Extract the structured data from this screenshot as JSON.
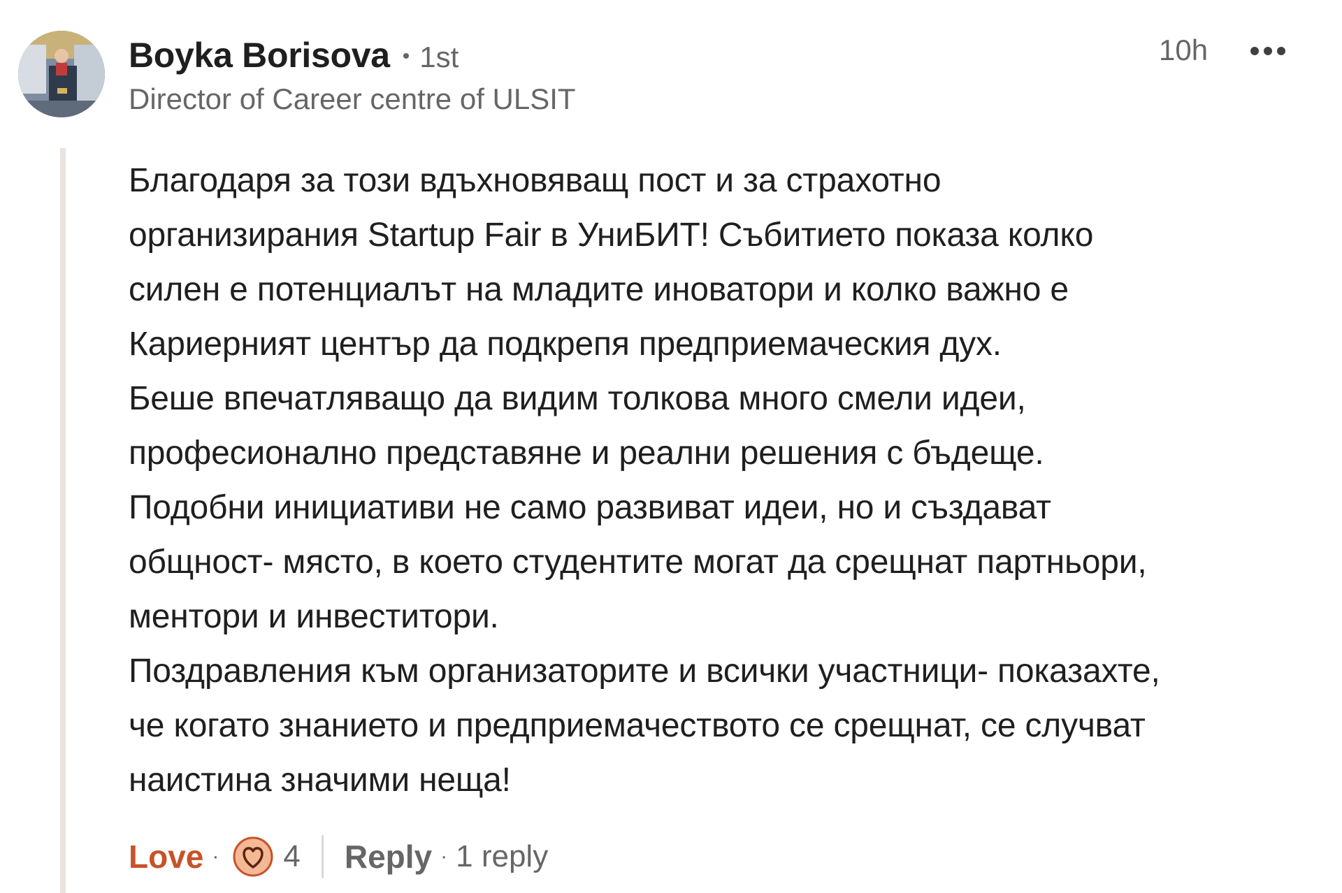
{
  "comment": {
    "author": {
      "name": "Boyka Borisova",
      "degree": "1st",
      "headline": "Director of Career centre of ULSIT"
    },
    "timestamp": "10h",
    "more_icon": "ellipsis-icon",
    "body_lines": [
      "Благодаря за този вдъхновяващ пост и за страхотно",
      "организирания Startup Fair в УниБИТ! Събитието показа колко",
      "силен е потенциалът на младите иноватори и колко важно е",
      "Кариерният център да подкрепя предприемаческия дух.",
      "Беше впечатляващо да видим толкова много смели идеи,",
      "професионално представяне и реални решения с бъдеще.",
      "Подобни инициативи не само развиват идеи, но и създават",
      "общност- място, в което студентите могат да срещнат партньори,",
      "ментори и инвеститори.",
      "Поздравления към организаторите и всички участници- показахте,",
      "че когато знанието и предприемачеството се срещнат, се случват",
      "наистина значими неща!"
    ],
    "actions": {
      "reaction_label": "Love",
      "reaction_icon": "love-heart-icon",
      "reaction_count": "4",
      "reply_label": "Reply",
      "reply_count": "1 reply",
      "separator": "·"
    }
  },
  "colors": {
    "love_accent": "#c6532a",
    "love_icon_fill": "#f5b895",
    "muted_text": "#666666",
    "thread_line": "#e8e3df"
  }
}
